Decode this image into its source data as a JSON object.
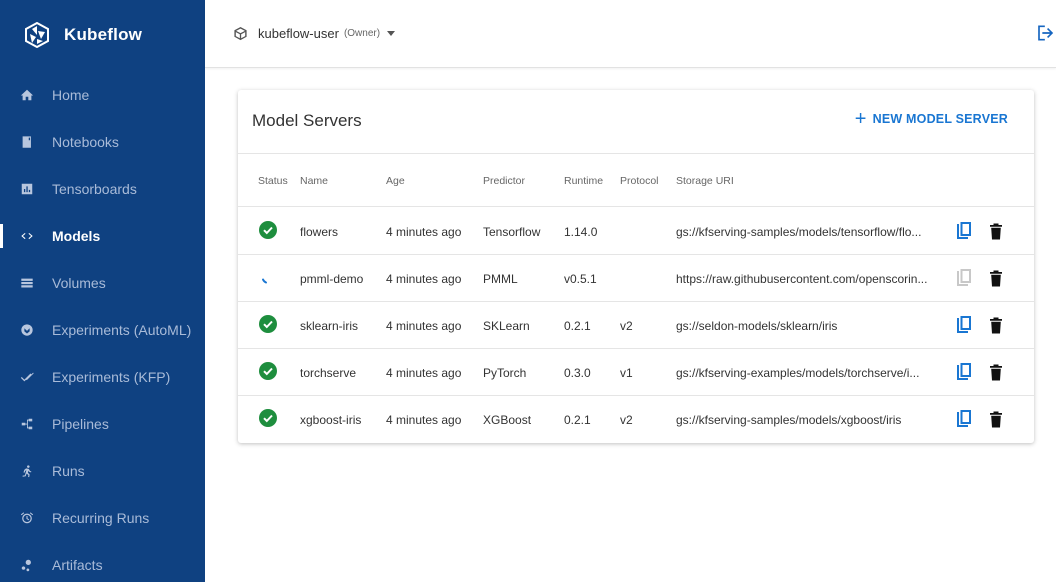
{
  "sidebar": {
    "brand": "Kubeflow",
    "items": [
      {
        "label": "Home",
        "icon": "home-icon"
      },
      {
        "label": "Notebooks",
        "icon": "notebook-icon"
      },
      {
        "label": "Tensorboards",
        "icon": "chart-icon"
      },
      {
        "label": "Models",
        "icon": "code-arrows-icon",
        "active": true
      },
      {
        "label": "Volumes",
        "icon": "storage-icon"
      },
      {
        "label": "Experiments (AutoML)",
        "icon": "experiment-icon"
      },
      {
        "label": "Experiments (KFP)",
        "icon": "done-all-icon"
      },
      {
        "label": "Pipelines",
        "icon": "pipeline-icon"
      },
      {
        "label": "Runs",
        "icon": "runner-icon"
      },
      {
        "label": "Recurring Runs",
        "icon": "alarm-icon"
      },
      {
        "label": "Artifacts",
        "icon": "bubbles-icon"
      }
    ]
  },
  "topbar": {
    "namespace": "kubeflow-user",
    "role": "(Owner)"
  },
  "card": {
    "title": "Model Servers",
    "new_button": "NEW MODEL SERVER",
    "columns": [
      "Status",
      "Name",
      "Age",
      "Predictor",
      "Runtime",
      "Protocol",
      "Storage URI"
    ],
    "rows": [
      {
        "status": "ready",
        "name": "flowers",
        "age": "4 minutes ago",
        "predictor": "Tensorflow",
        "runtime": "1.14.0",
        "protocol": "",
        "uri": "gs://kfserving-samples/models/tensorflow/flo...",
        "copy_enabled": true
      },
      {
        "status": "loading",
        "name": "pmml-demo",
        "age": "4 minutes ago",
        "predictor": "PMML",
        "runtime": "v0.5.1",
        "protocol": "",
        "uri": "https://raw.githubusercontent.com/openscorin...",
        "copy_enabled": false
      },
      {
        "status": "ready",
        "name": "sklearn-iris",
        "age": "4 minutes ago",
        "predictor": "SKLearn",
        "runtime": "0.2.1",
        "protocol": "v2",
        "uri": "gs://seldon-models/sklearn/iris",
        "copy_enabled": true
      },
      {
        "status": "ready",
        "name": "torchserve",
        "age": "4 minutes ago",
        "predictor": "PyTorch",
        "runtime": "0.3.0",
        "protocol": "v1",
        "uri": "gs://kfserving-examples/models/torchserve/i...",
        "copy_enabled": true
      },
      {
        "status": "ready",
        "name": "xgboost-iris",
        "age": "4 minutes ago",
        "predictor": "XGBoost",
        "runtime": "0.2.1",
        "protocol": "v2",
        "uri": "gs://kfserving-samples/models/xgboost/iris",
        "copy_enabled": true
      }
    ]
  },
  "colors": {
    "sidebar_bg": "#0f4181",
    "accent": "#1976d2",
    "success": "#1e8e3e"
  }
}
